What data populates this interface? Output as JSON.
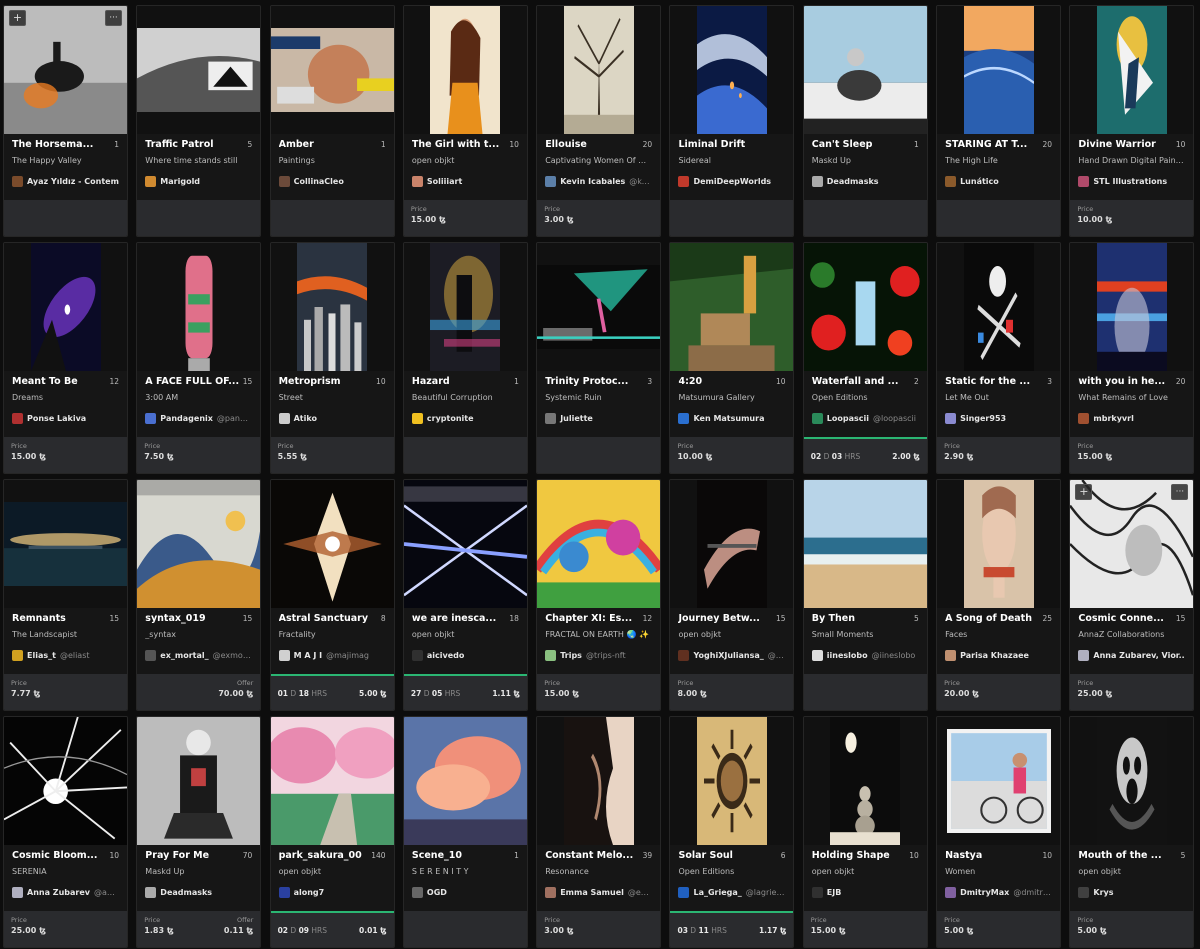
{
  "currency": "ꜩ",
  "labels": {
    "price": "Price",
    "offer": "Offer",
    "days": "D",
    "hours": "HRS",
    "add": "+",
    "more": "···"
  },
  "cards": [
    {
      "title": "The Horsema...",
      "editions": "1",
      "collection": "The Happy Valley",
      "artist": "Ayaz Yıldız - Contem...",
      "handle": "",
      "footer": "empty",
      "price": "",
      "offer": "",
      "days": "",
      "hours": "",
      "art": "horse",
      "shape": "full",
      "av": "#7a4b2b",
      "overlay": true
    },
    {
      "title": "Traffic Patrol",
      "editions": "5",
      "collection": "Where time stands still",
      "artist": "Marigold",
      "handle": "",
      "footer": "empty",
      "price": "",
      "offer": "",
      "days": "",
      "hours": "",
      "art": "traffic",
      "shape": "wide",
      "av": "#d08a30"
    },
    {
      "title": "Amber",
      "editions": "1",
      "collection": "Paintings",
      "artist": "CollinaCleo",
      "handle": "",
      "footer": "empty",
      "price": "",
      "offer": "",
      "days": "",
      "hours": "",
      "art": "amber",
      "shape": "wide",
      "av": "#6b4a3a"
    },
    {
      "title": "The Girl with t...",
      "editions": "10",
      "collection": "open objkt",
      "artist": "Soliiiart",
      "handle": "",
      "footer": "price",
      "price": "15.00",
      "offer": "",
      "days": "",
      "hours": "",
      "art": "girl",
      "shape": "portrait",
      "av": "#c9836a"
    },
    {
      "title": "Ellouise",
      "editions": "20",
      "collection": "Captivating Women Of We...",
      "artist": "Kevin Icabales",
      "handle": "@kev...",
      "footer": "price",
      "price": "3.00",
      "offer": "",
      "days": "",
      "hours": "",
      "art": "tree",
      "shape": "portrait",
      "av": "#5b7fa8"
    },
    {
      "title": "Liminal Drift",
      "editions": "",
      "collection": "Sidereal",
      "artist": "DemiDeepWorlds",
      "handle": "",
      "footer": "empty",
      "price": "",
      "offer": "",
      "days": "",
      "hours": "",
      "art": "drift",
      "shape": "portrait",
      "av": "#c0392b"
    },
    {
      "title": "Can't Sleep",
      "editions": "1",
      "collection": "Maskd Up",
      "artist": "Deadmasks",
      "handle": "",
      "footer": "empty",
      "price": "",
      "offer": "",
      "days": "",
      "hours": "",
      "art": "sleep",
      "shape": "full",
      "av": "#aaaaaa"
    },
    {
      "title": "STARING AT T...",
      "editions": "20",
      "collection": "The High Life",
      "artist": "Lunático",
      "handle": "",
      "footer": "empty",
      "price": "",
      "offer": "",
      "days": "",
      "hours": "",
      "art": "staring",
      "shape": "portrait",
      "av": "#8b5a2b"
    },
    {
      "title": "Divine Warrior",
      "editions": "10",
      "collection": "Hand Drawn Digital Painti...",
      "artist": "STL Illustrations",
      "handle": "",
      "footer": "price",
      "price": "10.00",
      "offer": "",
      "days": "",
      "hours": "",
      "art": "warrior",
      "shape": "portrait",
      "av": "#b04a6a"
    },
    {
      "title": "Meant To Be",
      "editions": "12",
      "collection": "Dreams",
      "artist": "Ponse Lakiva",
      "handle": "",
      "footer": "price",
      "price": "15.00",
      "offer": "",
      "days": "",
      "hours": "",
      "art": "meant",
      "shape": "portrait",
      "av": "#b03030"
    },
    {
      "title": "A FACE FULL OF...",
      "editions": "15",
      "collection": "3:00 AM",
      "artist": "Pandagenix",
      "handle": "@panda...",
      "footer": "price",
      "price": "7.50",
      "offer": "",
      "days": "",
      "hours": "",
      "art": "face",
      "shape": "narrow",
      "av": "#4a6fd0"
    },
    {
      "title": "Metroprism",
      "editions": "10",
      "collection": "Street",
      "artist": "Atiko",
      "handle": "",
      "footer": "price",
      "price": "5.55",
      "offer": "",
      "days": "",
      "hours": "",
      "art": "metro",
      "shape": "portrait",
      "av": "#cccccc"
    },
    {
      "title": "Hazard",
      "editions": "1",
      "collection": "Beautiful Corruption",
      "artist": "cryptonite",
      "handle": "",
      "footer": "empty",
      "price": "",
      "offer": "",
      "days": "",
      "hours": "",
      "art": "hazard",
      "shape": "portrait",
      "av": "#f0c020"
    },
    {
      "title": "Trinity Protoc...",
      "editions": "3",
      "collection": "Systemic Ruin",
      "artist": "Juliette",
      "handle": "",
      "footer": "empty",
      "price": "",
      "offer": "",
      "days": "",
      "hours": "",
      "art": "trinity",
      "shape": "wide",
      "av": "#777777"
    },
    {
      "title": "4:20",
      "editions": "10",
      "collection": "Matsumura Gallery",
      "artist": "Ken Matsumura",
      "handle": "",
      "footer": "price",
      "price": "10.00",
      "offer": "",
      "days": "",
      "hours": "",
      "art": "fourtwenty",
      "shape": "full",
      "av": "#2a6fd0"
    },
    {
      "title": "Waterfall and ...",
      "editions": "2",
      "collection": "Open Editions",
      "artist": "Loopascii",
      "handle": "@loopascii",
      "footer": "auction",
      "price": "2.00",
      "offer": "",
      "days": "02",
      "hours": "03",
      "art": "waterfall",
      "shape": "full",
      "av": "#2a8a5a"
    },
    {
      "title": "Static for the ...",
      "editions": "3",
      "collection": "Let Me Out",
      "artist": "Singer953",
      "handle": "",
      "footer": "price",
      "price": "2.90",
      "offer": "",
      "days": "",
      "hours": "",
      "art": "static",
      "shape": "portrait",
      "av": "#8a8ad0"
    },
    {
      "title": "with you in he...",
      "editions": "20",
      "collection": "What Remains of Love",
      "artist": "mbrkyvrl",
      "handle": "",
      "footer": "price",
      "price": "15.00",
      "offer": "",
      "days": "",
      "hours": "",
      "art": "withyou",
      "shape": "portrait",
      "av": "#a05030"
    },
    {
      "title": "Remnants",
      "editions": "15",
      "collection": "The Landscapist",
      "artist": "Elias_t",
      "handle": "@eliast",
      "footer": "price",
      "price": "7.77",
      "offer": "",
      "days": "",
      "hours": "",
      "art": "remnants",
      "shape": "wide",
      "av": "#d0a020"
    },
    {
      "title": "syntax_019",
      "editions": "15",
      "collection": "_syntax",
      "artist": "ex_mortal_",
      "handle": "@exmortal",
      "footer": "priceoffer",
      "price": "",
      "offer": "70.00",
      "days": "",
      "hours": "",
      "art": "syntax",
      "shape": "full",
      "av": "#555555"
    },
    {
      "title": "Astral Sanctuary",
      "editions": "8",
      "collection": "Fractality",
      "artist": "M A J I",
      "handle": "@majimag",
      "footer": "auction",
      "price": "5.00",
      "offer": "",
      "days": "01",
      "hours": "18",
      "art": "astral",
      "shape": "full",
      "av": "#d0d0d0"
    },
    {
      "title": "we are inesca...",
      "editions": "18",
      "collection": "open objkt",
      "artist": "aicivedo",
      "handle": "",
      "footer": "auction",
      "price": "1.11",
      "offer": "",
      "days": "27",
      "hours": "05",
      "art": "inescapable",
      "shape": "full",
      "av": "#303030"
    },
    {
      "title": "Chapter XI: Es...",
      "editions": "12",
      "collection": "FRACTAL ON EARTH 🌏 ✨",
      "artist": "Trips",
      "handle": "@trips-nft",
      "footer": "price",
      "price": "15.00",
      "offer": "",
      "days": "",
      "hours": "",
      "art": "chapter",
      "shape": "full",
      "av": "#8ac080"
    },
    {
      "title": "Journey Betw...",
      "editions": "15",
      "collection": "open objkt",
      "artist": "YoghiXJuliansa_",
      "handle": "@y...",
      "footer": "price",
      "price": "8.00",
      "offer": "",
      "days": "",
      "hours": "",
      "art": "journey",
      "shape": "portrait",
      "av": "#603020"
    },
    {
      "title": "By Then",
      "editions": "5",
      "collection": "Small Moments",
      "artist": "iineslobo",
      "handle": "@iineslobo",
      "footer": "empty",
      "price": "",
      "offer": "",
      "days": "",
      "hours": "",
      "art": "bythen",
      "shape": "full",
      "av": "#dddddd"
    },
    {
      "title": "A Song of Death",
      "editions": "25",
      "collection": "Faces",
      "artist": "Parisa Khazaee",
      "handle": "",
      "footer": "price",
      "price": "20.00",
      "offer": "",
      "days": "",
      "hours": "",
      "art": "song",
      "shape": "portrait",
      "av": "#c09070"
    },
    {
      "title": "Cosmic Conne...",
      "editions": "15",
      "collection": "AnnaZ Collaborations",
      "artist": "Anna Zubarev, Vior...",
      "handle": "",
      "footer": "price",
      "price": "25.00",
      "offer": "",
      "days": "",
      "hours": "",
      "art": "cosmicconn",
      "shape": "full",
      "av": "#b0b0c0",
      "overlay": true
    },
    {
      "title": "Cosmic Bloom...",
      "editions": "10",
      "collection": "SERENIA",
      "artist": "Anna Zubarev",
      "handle": "@ann...",
      "footer": "price",
      "price": "25.00",
      "offer": "",
      "days": "",
      "hours": "",
      "art": "bloom",
      "shape": "full",
      "av": "#b0b0c0"
    },
    {
      "title": "Pray For Me",
      "editions": "70",
      "collection": "Maskd Up",
      "artist": "Deadmasks",
      "handle": "",
      "footer": "priceoffer",
      "price": "1.83",
      "offer": "0.11",
      "days": "",
      "hours": "",
      "art": "pray",
      "shape": "full",
      "av": "#aaaaaa"
    },
    {
      "title": "park_sakura_00",
      "editions": "140",
      "collection": "open objkt",
      "artist": "along7",
      "handle": "",
      "footer": "auction",
      "price": "0.01",
      "offer": "",
      "days": "02",
      "hours": "09",
      "art": "sakura",
      "shape": "full",
      "av": "#2a40a0"
    },
    {
      "title": "Scene_10",
      "editions": "1",
      "collection": "S E R E N I T Y",
      "artist": "OGD",
      "handle": "",
      "footer": "empty",
      "price": "",
      "offer": "",
      "days": "",
      "hours": "",
      "art": "scene",
      "shape": "full",
      "av": "#666666"
    },
    {
      "title": "Constant Melo...",
      "editions": "39",
      "collection": "Resonance",
      "artist": "Emma Samuel",
      "handle": "@em...",
      "footer": "price",
      "price": "3.00",
      "offer": "",
      "days": "",
      "hours": "",
      "art": "melody",
      "shape": "portrait",
      "av": "#a07060"
    },
    {
      "title": "Solar Soul",
      "editions": "6",
      "collection": "Open Editions",
      "artist": "La_Griega_",
      "handle": "@lagriega",
      "footer": "auction",
      "price": "1.17",
      "offer": "",
      "days": "03",
      "hours": "11",
      "art": "solar",
      "shape": "portrait",
      "av": "#2060c0"
    },
    {
      "title": "Holding Shape",
      "editions": "10",
      "collection": "open objkt",
      "artist": "EJB",
      "handle": "",
      "footer": "price",
      "price": "15.00",
      "offer": "",
      "days": "",
      "hours": "",
      "art": "holding",
      "shape": "portrait",
      "av": "#303030"
    },
    {
      "title": "Nastya",
      "editions": "10",
      "collection": "Women",
      "artist": "DmitryMax",
      "handle": "@dmitry...",
      "footer": "price",
      "price": "5.00",
      "offer": "",
      "days": "",
      "hours": "",
      "art": "nastya",
      "shape": "square",
      "av": "#8060a0"
    },
    {
      "title": "Mouth of the ...",
      "editions": "5",
      "collection": "open objkt",
      "artist": "Krys",
      "handle": "",
      "footer": "price",
      "price": "5.00",
      "offer": "",
      "days": "",
      "hours": "",
      "art": "mouth",
      "shape": "portrait",
      "av": "#404040"
    }
  ]
}
